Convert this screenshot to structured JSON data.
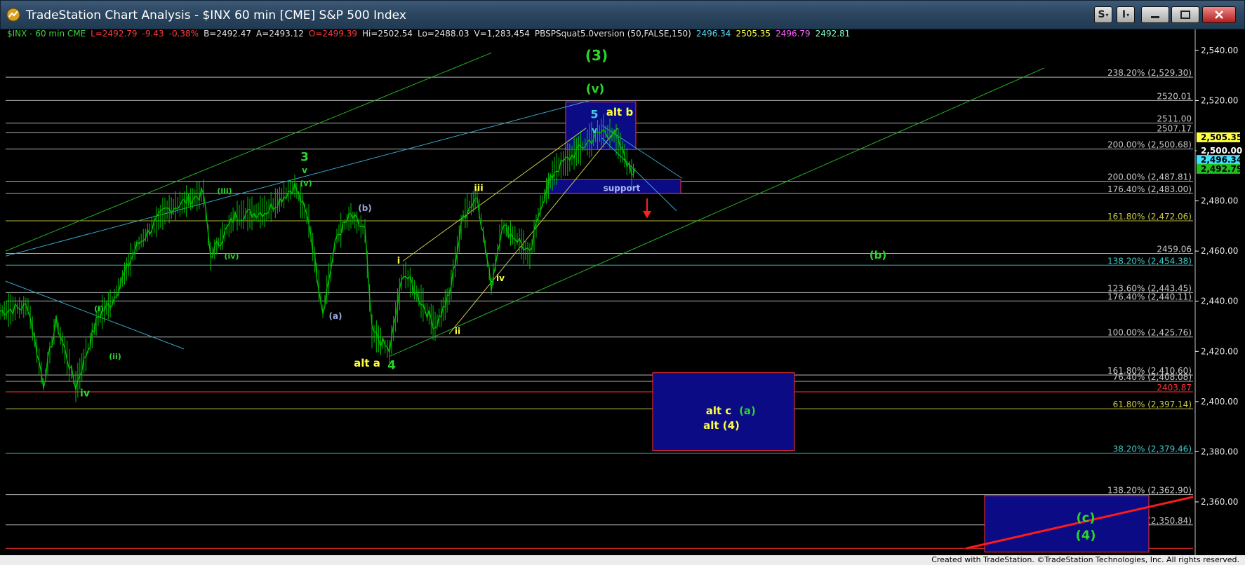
{
  "window": {
    "title": "TradeStation Chart Analysis - $INX 60 min [CME] S&P 500 Index",
    "buttons": [
      "S",
      "I"
    ]
  },
  "header": {
    "segments": [
      {
        "text": "$INX - 60 min  CME",
        "color": "#3cd23c"
      },
      {
        "text": "L=2492.79",
        "color": "#ff3a3a"
      },
      {
        "text": "-9.43",
        "color": "#ff3a3a"
      },
      {
        "text": "-0.38%",
        "color": "#ff3a3a"
      },
      {
        "text": "B=2492.47",
        "color": "#e0e0e0"
      },
      {
        "text": "A=2493.12",
        "color": "#e0e0e0"
      },
      {
        "text": "O=2499.39",
        "color": "#ff3a3a"
      },
      {
        "text": "Hi=2502.54",
        "color": "#e0e0e0"
      },
      {
        "text": "Lo=2488.03",
        "color": "#e0e0e0"
      },
      {
        "text": "V=1,283,454",
        "color": "#e0e0e0"
      },
      {
        "text": "PBSPSquat5.0version (50,FALSE,150)",
        "color": "#e0e0e0"
      },
      {
        "text": "2496.34",
        "color": "#4ee0ff"
      },
      {
        "text": "2505.35",
        "color": "#ffff40"
      },
      {
        "text": "2496.79",
        "color": "#ff60ff"
      },
      {
        "text": "2492.81",
        "color": "#80ffc0"
      }
    ]
  },
  "chart_data": {
    "type": "line",
    "title": "$INX - 60 min  CME",
    "ylim": [
      2341,
      2545
    ],
    "y_ticks": [
      2360,
      2380,
      2400,
      2420,
      2440,
      2460,
      2480,
      2500,
      2520,
      2540
    ],
    "y_tick_labels": [
      "2,360.00",
      "2,380.00",
      "2,400.00",
      "2,420.00",
      "2,440.00",
      "2,460.00",
      "2,480.00",
      "2,500.00",
      "2,520.00",
      "2,540.00"
    ],
    "x_range": [
      0,
      1700
    ],
    "grid": false,
    "series": [
      {
        "color": "#00c000",
        "values": [
          [
            0,
            2436
          ],
          [
            40,
            2438
          ],
          [
            62,
            2407
          ],
          [
            80,
            2432
          ],
          [
            108,
            2406
          ],
          [
            140,
            2434
          ],
          [
            160,
            2440
          ],
          [
            195,
            2462
          ],
          [
            235,
            2476
          ],
          [
            290,
            2483
          ],
          [
            300,
            2458
          ],
          [
            335,
            2474
          ],
          [
            380,
            2476
          ],
          [
            420,
            2486
          ],
          [
            440,
            2472
          ],
          [
            460,
            2436
          ],
          [
            480,
            2466
          ],
          [
            500,
            2474
          ],
          [
            520,
            2468
          ],
          [
            530,
            2428
          ],
          [
            555,
            2420
          ],
          [
            575,
            2452
          ],
          [
            600,
            2440
          ],
          [
            620,
            2430
          ],
          [
            640,
            2442
          ],
          [
            660,
            2474
          ],
          [
            680,
            2482
          ],
          [
            700,
            2446
          ],
          [
            715,
            2470
          ],
          [
            740,
            2464
          ],
          [
            755,
            2458
          ],
          [
            770,
            2478
          ],
          [
            790,
            2492
          ],
          [
            815,
            2498
          ],
          [
            840,
            2504
          ],
          [
            860,
            2508
          ],
          [
            875,
            2506
          ],
          [
            890,
            2498
          ],
          [
            900,
            2491
          ],
          [
            905,
            2493
          ]
        ]
      }
    ],
    "annotations": [
      {
        "text": "(3)",
        "x": 850,
        "y": 2536,
        "color": "#2ad62a",
        "size": 20
      },
      {
        "text": "(v)",
        "x": 848,
        "y": 2523,
        "color": "#2ad62a",
        "size": 17
      },
      {
        "text": "5",
        "x": 847,
        "y": 2513,
        "color": "#40d0e0",
        "size": 16
      },
      {
        "text": "v",
        "x": 847,
        "y": 2507,
        "color": "#40d0e0",
        "size": 12
      },
      {
        "text": "alt b",
        "x": 883,
        "y": 2514,
        "color": "#ffff40",
        "size": 15
      },
      {
        "text": "3",
        "x": 434,
        "y": 2496,
        "color": "#2ad62a",
        "size": 17
      },
      {
        "text": "v",
        "x": 434,
        "y": 2491,
        "color": "#2ad62a",
        "size": 12
      },
      {
        "text": "(v)",
        "x": 436,
        "y": 2486,
        "color": "#2ad62a",
        "size": 11
      },
      {
        "text": "(iii)",
        "x": 320,
        "y": 2483,
        "color": "#2ad62a",
        "size": 11
      },
      {
        "text": "(iv)",
        "x": 330,
        "y": 2457,
        "color": "#2ad62a",
        "size": 11
      },
      {
        "text": "(b)",
        "x": 520,
        "y": 2476,
        "color": "#9aa8d8",
        "size": 12
      },
      {
        "text": "(a)",
        "x": 478,
        "y": 2433,
        "color": "#9aa8d8",
        "size": 12
      },
      {
        "text": "iii",
        "x": 682,
        "y": 2484,
        "color": "#ffff40",
        "size": 13
      },
      {
        "text": "i",
        "x": 568,
        "y": 2455,
        "color": "#ffff40",
        "size": 13
      },
      {
        "text": "iv",
        "x": 713,
        "y": 2448,
        "color": "#ffff40",
        "size": 12
      },
      {
        "text": "ii",
        "x": 652,
        "y": 2427,
        "color": "#ffff40",
        "size": 12
      },
      {
        "text": "alt a",
        "x": 523,
        "y": 2414,
        "color": "#ffff40",
        "size": 15
      },
      {
        "text": "4",
        "x": 558,
        "y": 2413,
        "color": "#2ad62a",
        "size": 17
      },
      {
        "text": "(i)",
        "x": 141,
        "y": 2436,
        "color": "#2ad62a",
        "size": 11
      },
      {
        "text": "(ii)",
        "x": 164,
        "y": 2417,
        "color": "#2ad62a",
        "size": 11
      },
      {
        "text": "iv",
        "x": 121,
        "y": 2402,
        "color": "#2ad62a",
        "size": 14
      },
      {
        "text": "support",
        "x": 886,
        "y": 2484,
        "color": "#a8b8f0",
        "size": 12
      },
      {
        "text": "(b)",
        "x": 1251,
        "y": 2457,
        "color": "#2ad62a",
        "size": 15
      },
      {
        "text": "alt c",
        "x": 1024,
        "y": 2395,
        "color": "#ffff40",
        "size": 15
      },
      {
        "text": "(a)",
        "x": 1065,
        "y": 2395,
        "color": "#2ad62a",
        "size": 15
      },
      {
        "text": "alt (4)",
        "x": 1028,
        "y": 2389,
        "color": "#ffff40",
        "size": 15
      },
      {
        "text": "(c)",
        "x": 1547,
        "y": 2352,
        "color": "#2ad62a",
        "size": 18
      },
      {
        "text": "(4)",
        "x": 1547,
        "y": 2345,
        "color": "#2ad62a",
        "size": 18
      }
    ],
    "levels": [
      {
        "text": "238.20% (2,529.30)",
        "value": 2529.3,
        "color": "#c8c8c8"
      },
      {
        "text": "2520.01",
        "value": 2520.01,
        "color": "#c8c8c8"
      },
      {
        "text": "2511.00",
        "value": 2511.0,
        "color": "#c8c8c8"
      },
      {
        "text": "2507.17",
        "value": 2507.17,
        "color": "#c8c8c8"
      },
      {
        "text": "200.00% (2,500.68)",
        "value": 2500.68,
        "color": "#c8c8c8"
      },
      {
        "text": "200.00% (2,487.81)",
        "value": 2487.81,
        "color": "#c8c8c8"
      },
      {
        "text": "176.40% (2,483.00)",
        "value": 2483.0,
        "color": "#c8c8c8"
      },
      {
        "text": "161.80% (2,472.06)",
        "value": 2472.06,
        "color": "#c8c84a"
      },
      {
        "text": "2459.06",
        "value": 2459.06,
        "color": "#c8c8c8"
      },
      {
        "text": "138.20% (2,454.38)",
        "value": 2454.38,
        "color": "#40c8c8"
      },
      {
        "text": "123.60% (2,443.45)",
        "value": 2443.45,
        "color": "#c8c8c8"
      },
      {
        "text": "176.40% (2,440.11)",
        "value": 2440.11,
        "color": "#c8c8c8"
      },
      {
        "text": "100.00% (2,425.76)",
        "value": 2425.76,
        "color": "#c8c8c8"
      },
      {
        "text": "161.80% (2,410.60)",
        "value": 2410.6,
        "color": "#c8c8c8"
      },
      {
        "text": "76.40% (2,408.08)",
        "value": 2408.08,
        "color": "#c8c8c8"
      },
      {
        "text": "2403.87",
        "value": 2403.87,
        "color": "#ff3030"
      },
      {
        "text": "61.80% (2,397.14)",
        "value": 2397.14,
        "color": "#c8c84a"
      },
      {
        "text": "38.20% (2,379.46)",
        "value": 2379.46,
        "color": "#40c8c8"
      },
      {
        "text": "138.20% (2,362.90)",
        "value": 2362.9,
        "color": "#c8c8c8"
      },
      {
        "text": "0.00% (2,350.84)",
        "value": 2350.84,
        "color": "#c8c8c8"
      }
    ],
    "price_tags": [
      {
        "text": "2,505.35",
        "value": 2505.35,
        "color": "#ffff40",
        "text_color": "#000"
      },
      {
        "text": "2,500.00",
        "value": 2500.0,
        "color": "#000000",
        "text_color": "#ffffff"
      },
      {
        "text": "2,496.34",
        "value": 2496.34,
        "color": "#40e0ff",
        "text_color": "#000"
      },
      {
        "text": "2,492.79",
        "value": 2492.79,
        "color": "#20c020",
        "text_color": "#000"
      }
    ]
  },
  "footer": {
    "text": "Created with TradeStation. ©TradeStation Technologies, Inc. All rights reserved."
  }
}
